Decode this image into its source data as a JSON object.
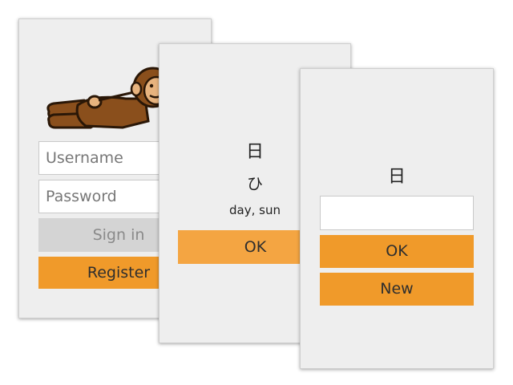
{
  "login_card": {
    "username_placeholder": "Username",
    "password_placeholder": "Password",
    "sign_in_label": "Sign in",
    "register_label": "Register",
    "mascot": "monkey-mascot-icon"
  },
  "flashcard": {
    "kanji": "日",
    "reading": "ひ",
    "meaning": "day, sun",
    "ok_label": "OK"
  },
  "quiz_card": {
    "kanji": "日",
    "answer_value": "",
    "ok_label": "OK",
    "new_label": "New"
  },
  "colors": {
    "card_background": "#eeeeee",
    "accent_orange": "#f09a2a",
    "disabled_gray": "#d4d4d4"
  }
}
